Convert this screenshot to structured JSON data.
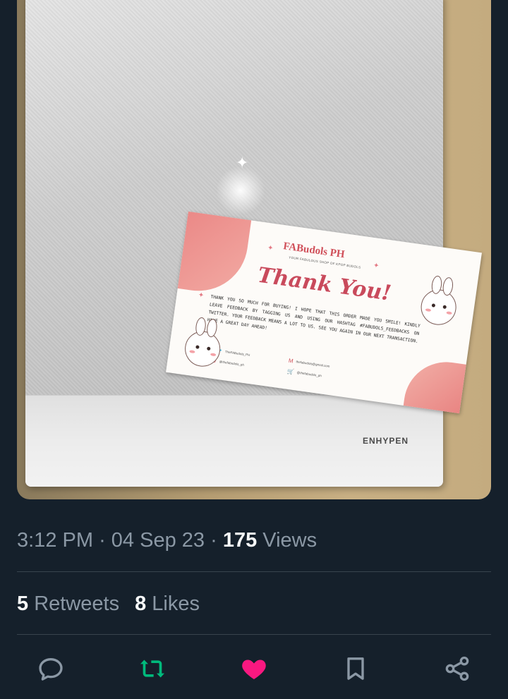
{
  "tweet": {
    "photo": {
      "album_brand": "ENHYPEN",
      "card": {
        "shop_name": "FABudols PH",
        "tagline": "YOUR FABULOUS SHOP OF KPOP BUDOLS",
        "heading": "Thank You!",
        "message": "Thank you so much for buying! I hope that this order made you smile! Kindly leave feedback by tagging us and using our hashtag #FABudols_Feedbacks on Twitter. Your feedback means a lot to us. See you again in our next transaction. Have a great day ahead!",
        "twitter": "TheFABudols_PH",
        "tiktok": "@thefabudols_ph",
        "email": "thefabudols@gmail.com",
        "shopee": "@thefabudols_ph"
      }
    },
    "time": "3:12 PM",
    "date": "04 Sep 23",
    "sep": "·",
    "views_count": "175",
    "views_label": "Views",
    "retweets_count": "5",
    "retweets_label": "Retweets",
    "likes_count": "8",
    "likes_label": "Likes"
  },
  "actions": {
    "reply_icon": "reply-icon",
    "retweet_icon": "retweet-icon",
    "like_icon": "heart-icon",
    "bookmark_icon": "bookmark-icon",
    "share_icon": "share-icon"
  },
  "colors": {
    "background": "#15202b",
    "text_primary": "#f7f9f9",
    "text_secondary": "#8b98a5",
    "divider": "#38444d",
    "retweet_active": "#00ba7c",
    "like_active": "#f91880",
    "icon_default": "#8b98a5"
  }
}
